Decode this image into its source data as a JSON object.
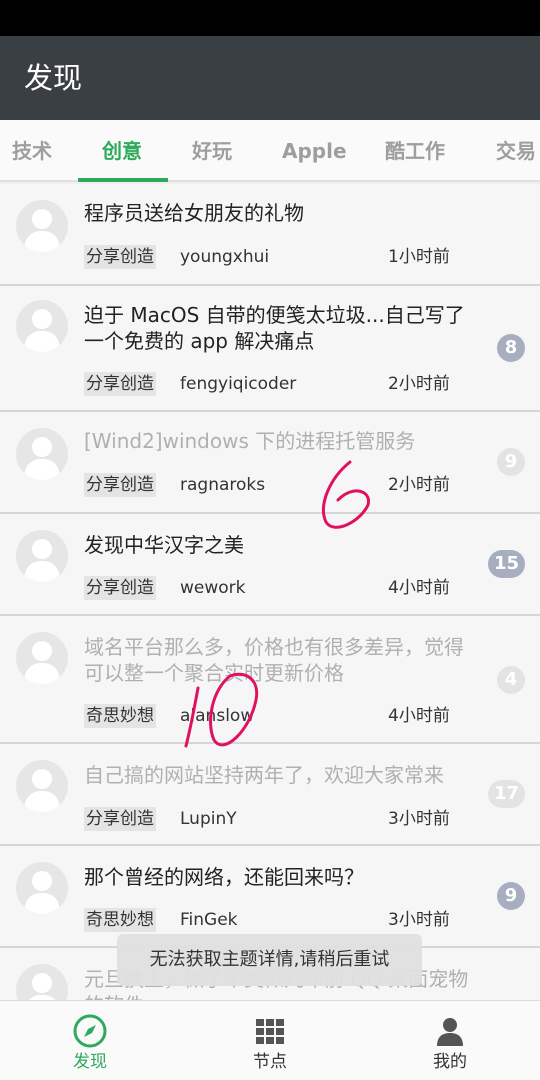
{
  "app_bar": {
    "title": "发现"
  },
  "tabs": [
    {
      "label": "技术",
      "active": false
    },
    {
      "label": "创意",
      "active": true
    },
    {
      "label": "好玩",
      "active": false
    },
    {
      "label": "Apple",
      "active": false
    },
    {
      "label": "酷工作",
      "active": false
    },
    {
      "label": "交易",
      "active": false
    }
  ],
  "topics": [
    {
      "title": "程序员送给女朋友的礼物",
      "node": "分享创造",
      "user": "youngxhui",
      "time": "1小时前",
      "replies": "",
      "dim": false
    },
    {
      "title": "迫于 MacOS 自带的便笺太垃圾...自己写了一个免费的 app 解决痛点",
      "node": "分享创造",
      "user": "fengyiqicoder",
      "time": "2小时前",
      "replies": "8",
      "dim": false
    },
    {
      "title": "[Wind2]windows 下的进程托管服务",
      "node": "分享创造",
      "user": "ragnaroks",
      "time": "2小时前",
      "replies": "9",
      "dim": true
    },
    {
      "title": "发现中华汉字之美",
      "node": "分享创造",
      "user": "wework",
      "time": "4小时前",
      "replies": "15",
      "dim": false
    },
    {
      "title": "域名平台那么多，价格也有很多差异，觉得可以整一个聚合实时更新价格",
      "node": "奇思妙想",
      "user": "alanslow",
      "time": "4小时前",
      "replies": "4",
      "dim": true
    },
    {
      "title": "自己搞的网站坚持两年了，欢迎大家常来",
      "node": "分享创造",
      "user": "LupinY",
      "time": "3小时前",
      "replies": "17",
      "dim": true
    },
    {
      "title": "那个曾经的网络，还能回来吗？",
      "node": "奇思妙想",
      "user": "FinGek",
      "time": "3小时前",
      "replies": "9",
      "dim": false
    },
    {
      "title": "元旦换上，做了个类似几年前 QQ 桌面宠物的软件",
      "node": "",
      "user": "",
      "time": "",
      "replies": "",
      "dim": true
    }
  ],
  "toast": {
    "message": "无法获取主题详情,请稍后重试"
  },
  "bottom_nav": [
    {
      "label": "发现",
      "icon": "compass-icon",
      "active": true
    },
    {
      "label": "节点",
      "icon": "grid-icon",
      "active": false
    },
    {
      "label": "我的",
      "icon": "person-icon",
      "active": false
    }
  ],
  "colors": {
    "accent": "#2eaa5c",
    "app_bar": "#3a3f44",
    "badge": "#a7aec0",
    "annotation": "#e0115f"
  }
}
